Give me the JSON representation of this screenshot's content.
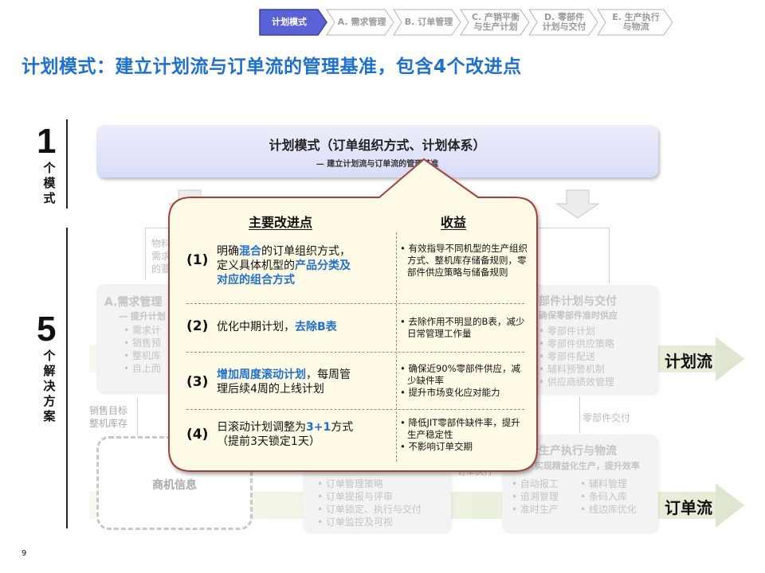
{
  "nav": {
    "items": [
      {
        "label": "计划模式",
        "active": true
      },
      {
        "label": "A. 需求管理",
        "active": false
      },
      {
        "label": "B. 订单管理",
        "active": false
      },
      {
        "label": "C. 产销平衡\n与生产计划",
        "active": false
      },
      {
        "label": "D. 零部件\n计划与交付",
        "active": false
      },
      {
        "label": "E. 生产执行\n与物流",
        "active": false
      }
    ]
  },
  "title": "计划模式：建立计划流与订单流的管理基准，包含4个改进点",
  "left": {
    "num1": "1",
    "label1": "个模式",
    "num5": "5",
    "label5": "个解决方案"
  },
  "model": {
    "title": "计划模式（订单组织方式、计划体系）",
    "subtitle": "— 建立计划流与订单流的管理基准"
  },
  "background": {
    "a_box": {
      "title": "A.需求管理",
      "sub": "— 提升计划",
      "items": [
        "需求计",
        "销售预",
        "整机库",
        "自上而"
      ]
    },
    "d_box": {
      "title": "部件计划与交付",
      "sub": "确保零部件准时供应",
      "items": [
        "零部件计划",
        "零部件供应策略",
        "零部件配送",
        "辅料预警机制",
        "供应商绩效管理"
      ]
    },
    "e_box": {
      "title": "生产执行与物流",
      "sub": "— 实现精益化生产，提升效率",
      "items_left": [
        "自动报工",
        "追溯管理",
        "准时生产"
      ],
      "items_right": [
        "辅料管理",
        "条码入库",
        "线边库优化"
      ]
    },
    "b_items": [
      "订单管理策略",
      "订单提报与评审",
      "订单锁定、执行与交付",
      "订单监控及可视"
    ],
    "business_info": "商机信息",
    "sales_target": "销售目标",
    "stock": "整机库存",
    "parts_delivery": "零部件交付",
    "faded_left_top": [
      "物料",
      "需求",
      "的要"
    ],
    "order_exec": "订单执行",
    "plan_flow": "计划流",
    "order_flow": "订单流"
  },
  "callout": {
    "head_left": "主要改进点",
    "head_right": "收益",
    "rows": [
      {
        "num": "(1)",
        "text_parts": [
          {
            "t": "明确",
            "hl": false
          },
          {
            "t": "混合",
            "hl": true
          },
          {
            "t": "的订单组织方式，",
            "hl": false
          },
          {
            "t": "\n定义具体机型的",
            "hl": false
          },
          {
            "t": "产品分类及\n对应的组合方式",
            "hl": true
          }
        ],
        "benefits": [
          "有效指导不同机型的生产组织方式、整机库存储备规则，零部件供应策略与储备规则"
        ]
      },
      {
        "num": "(2)",
        "text_parts": [
          {
            "t": "优化中期计划，",
            "hl": false
          },
          {
            "t": "去除B表",
            "hl": true
          }
        ],
        "benefits": [
          "去除作用不明显的B表，减少日常管理工作量"
        ]
      },
      {
        "num": "(3)",
        "text_parts": [
          {
            "t": "增加周度滚动计划",
            "hl": true
          },
          {
            "t": "，每周管\n理后续4周的上线计划",
            "hl": false
          }
        ],
        "benefits": [
          "确保近90%零部件供应，减少缺件率",
          "提升市场变化应对能力"
        ]
      },
      {
        "num": "(4)",
        "text_parts": [
          {
            "t": "日滚动计划调整为",
            "hl": false
          },
          {
            "t": "3+1",
            "hl": true
          },
          {
            "t": "方式\n（提前3天锁定1天）",
            "hl": false
          }
        ],
        "benefits": [
          "降低JIT零部件缺件率，提升生产稳定性",
          "不影响订单交期"
        ]
      }
    ]
  },
  "page_number": "9",
  "colors": {
    "accent": "#1f6fd0",
    "callout_fill": "#fffbe6",
    "callout_border": "#a3423c",
    "nav_active": "#5b62d6"
  }
}
